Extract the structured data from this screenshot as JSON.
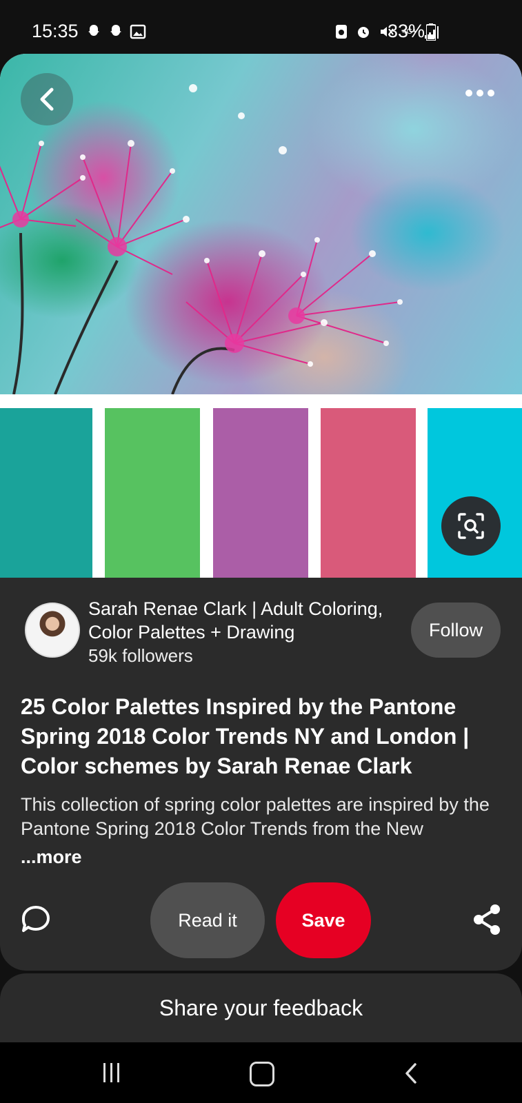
{
  "status_bar": {
    "time": "15:35",
    "left_icons": [
      "snapchat-icon",
      "snapchat-icon",
      "image-icon"
    ],
    "right_icons": [
      "sim-icon",
      "alarm-icon",
      "mute-icon",
      "network-4g-icon",
      "signal-icon"
    ],
    "network_label": "4G+",
    "battery_percent": "33%"
  },
  "pin": {
    "palette_colors": [
      "#1aa39a",
      "#57c260",
      "#ab5ea7",
      "#d95a7a",
      "#00c7dd"
    ],
    "back_icon": "chevron-left-icon",
    "menu_icon": "more-dots-icon",
    "lens_icon": "visual-search-icon"
  },
  "creator": {
    "name": "Sarah Renae Clark | Adult Coloring, Color Palettes + Drawing",
    "followers": "59k followers",
    "follow_label": "Follow"
  },
  "title": "25 Color Palettes Inspired by the Pantone Spring 2018 Color Trends NY and London | Color schemes by Sarah Renae Clark",
  "description": "This collection of spring color palettes are inspired by the Pantone Spring 2018 Color Trends from the New",
  "more_label": "...more",
  "actions": {
    "read_label": "Read it",
    "save_label": "Save",
    "save_color": "#e60023"
  },
  "feedback_label": "Share your feedback"
}
